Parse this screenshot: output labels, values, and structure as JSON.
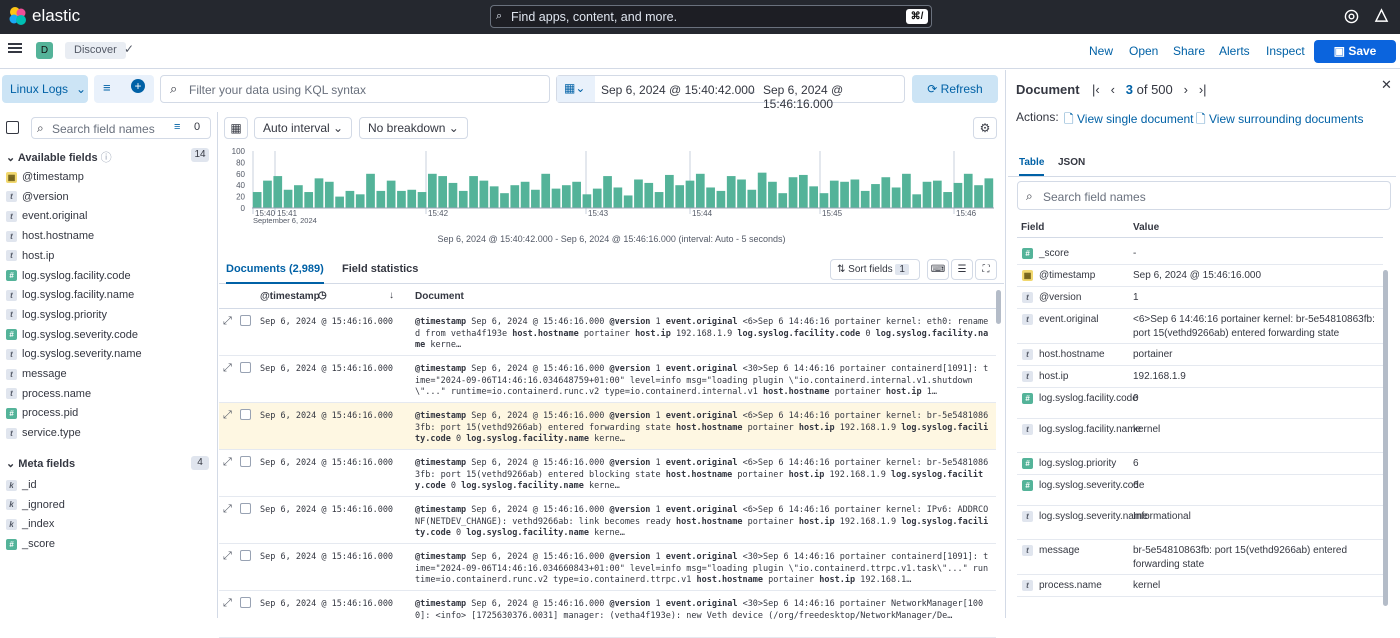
{
  "header": {
    "brand": "elastic",
    "search_placeholder": "Find apps, content, and more.",
    "search_shortcut": "⌘/"
  },
  "subheader": {
    "space_letter": "D",
    "breadcrumb": "Discover",
    "links": [
      "New",
      "Open",
      "Share",
      "Alerts",
      "Inspect"
    ],
    "save_label": "Save"
  },
  "querybar": {
    "dataview": "Linux Logs",
    "kql_placeholder": "Filter your data using KQL syntax",
    "date_start": "Sep 6, 2024 @ 15:40:42.000",
    "date_arrow": "→",
    "date_end": "Sep 6, 2024 @ 15:46:16.000",
    "refresh_label": "Refresh"
  },
  "sidebar": {
    "search_placeholder": "Search field names",
    "filter_count": "0",
    "available_title": "Available fields",
    "available_count": "14",
    "available": [
      {
        "type": "date",
        "name": "@timestamp"
      },
      {
        "type": "str",
        "name": "@version"
      },
      {
        "type": "str",
        "name": "event.original"
      },
      {
        "type": "str",
        "name": "host.hostname"
      },
      {
        "type": "str",
        "name": "host.ip"
      },
      {
        "type": "num",
        "name": "log.syslog.facility.code"
      },
      {
        "type": "str",
        "name": "log.syslog.facility.name"
      },
      {
        "type": "str",
        "name": "log.syslog.priority"
      },
      {
        "type": "num",
        "name": "log.syslog.severity.code"
      },
      {
        "type": "str",
        "name": "log.syslog.severity.name"
      },
      {
        "type": "str",
        "name": "message"
      },
      {
        "type": "str",
        "name": "process.name"
      },
      {
        "type": "num",
        "name": "process.pid"
      },
      {
        "type": "str",
        "name": "service.type"
      }
    ],
    "meta_title": "Meta fields",
    "meta_count": "4",
    "meta": [
      {
        "type": "kw",
        "name": "_id"
      },
      {
        "type": "kw",
        "name": "_ignored"
      },
      {
        "type": "kw",
        "name": "_index"
      },
      {
        "type": "num",
        "name": "_score"
      }
    ]
  },
  "chart_controls": {
    "interval": "Auto interval",
    "breakdown": "No breakdown"
  },
  "chart_data": {
    "type": "bar",
    "y_ticks": [
      "100",
      "80",
      "60",
      "40",
      "20",
      "0"
    ],
    "ylim": [
      0,
      100
    ],
    "x_ticks": [
      "15:40",
      "15:41",
      "15:42",
      "15:43",
      "15:44",
      "15:45",
      "15:46"
    ],
    "x_sublabel": "September 6, 2024",
    "caption": "Sep 6, 2024 @ 15:40:42.000 - Sep 6, 2024 @ 15:46:16.000 (interval: Auto - 5 seconds)",
    "values": [
      28,
      48,
      56,
      32,
      40,
      28,
      52,
      46,
      20,
      30,
      24,
      60,
      30,
      48,
      30,
      32,
      28,
      60,
      56,
      44,
      30,
      56,
      48,
      38,
      26,
      40,
      46,
      32,
      60,
      34,
      40,
      46,
      24,
      34,
      56,
      36,
      22,
      50,
      44,
      28,
      58,
      40,
      48,
      60,
      36,
      30,
      56,
      50,
      32,
      62,
      46,
      26,
      54,
      58,
      38,
      26,
      48,
      46,
      50,
      30,
      42,
      54,
      36,
      60,
      24,
      46,
      48,
      28,
      44,
      60,
      40,
      52
    ]
  },
  "docs": {
    "tab_documents": "Documents (2,989)",
    "tab_stats": "Field statistics",
    "sort_label": "Sort fields",
    "sort_count": "1",
    "col_timestamp": "@timestamp",
    "col_document": "Document",
    "rows": [
      {
        "ts": "Sep 6, 2024 @ 15:46:16.000",
        "doc": "@timestamp Sep 6, 2024 @ 15:46:16.000 @version 1 event.original <6>Sep 6 14:46:16 portainer kernel: eth0: renamed from vetha4f193e host.hostname portainer host.ip 192.168.1.9 log.syslog.facility.code 0 log.syslog.facility.name kerne…"
      },
      {
        "ts": "Sep 6, 2024 @ 15:46:16.000",
        "doc": "@timestamp Sep 6, 2024 @ 15:46:16.000 @version 1 event.original <30>Sep 6 14:46:16 portainer containerd[1091]: time=\"2024-09-06T14:46:16.034648759+01:00\" level=info msg=\"loading plugin \\\"io.containerd.internal.v1.shutdown\\\"...\" runtime=io.containerd.runc.v2 type=io.containerd.internal.v1 host.hostname portainer host.ip 1…"
      },
      {
        "ts": "Sep 6, 2024 @ 15:46:16.000",
        "doc": "@timestamp Sep 6, 2024 @ 15:46:16.000 @version 1 event.original <6>Sep 6 14:46:16 portainer kernel: br-5e54810863fb: port 15(vethd9266ab) entered forwarding state host.hostname portainer host.ip 192.168.1.9 log.syslog.facility.code 0 log.syslog.facility.name kerne…"
      },
      {
        "ts": "Sep 6, 2024 @ 15:46:16.000",
        "doc": "@timestamp Sep 6, 2024 @ 15:46:16.000 @version 1 event.original <6>Sep 6 14:46:16 portainer kernel: br-5e54810863fb: port 15(vethd9266ab) entered blocking state host.hostname portainer host.ip 192.168.1.9 log.syslog.facility.code 0 log.syslog.facility.name kerne…"
      },
      {
        "ts": "Sep 6, 2024 @ 15:46:16.000",
        "doc": "@timestamp Sep 6, 2024 @ 15:46:16.000 @version 1 event.original <6>Sep 6 14:46:16 portainer kernel: IPv6: ADDRCONF(NETDEV_CHANGE): vethd9266ab: link becomes ready host.hostname portainer host.ip 192.168.1.9 log.syslog.facility.code 0 log.syslog.facility.name kerne…"
      },
      {
        "ts": "Sep 6, 2024 @ 15:46:16.000",
        "doc": "@timestamp Sep 6, 2024 @ 15:46:16.000 @version 1 event.original <30>Sep 6 14:46:16 portainer containerd[1091]: time=\"2024-09-06T14:46:16.034660843+01:00\" level=info msg=\"loading plugin \\\"io.containerd.ttrpc.v1.task\\\"...\" runtime=io.containerd.runc.v2 type=io.containerd.ttrpc.v1 host.hostname portainer host.ip 192.168.1…"
      },
      {
        "ts": "Sep 6, 2024 @ 15:46:16.000",
        "doc": "@timestamp Sep 6, 2024 @ 15:46:16.000 @version 1 event.original <30>Sep 6 14:46:16 portainer NetworkManager[1000]: <info> [1725630376.0031] manager: (vetha4f193e): new Veth device (/org/freedesktop/NetworkManager/De…"
      }
    ]
  },
  "flyout": {
    "title": "Document",
    "page_current": "3",
    "page_of": "of",
    "page_total": "500",
    "actions_label": "Actions:",
    "action_single": "View single document",
    "action_surrounding": "View surrounding documents",
    "tab_table": "Table",
    "tab_json": "JSON",
    "search_placeholder": "Search field names",
    "col_field": "Field",
    "col_value": "Value",
    "rows": [
      {
        "type": "num",
        "field": "_score",
        "value": "-"
      },
      {
        "type": "date",
        "field": "@timestamp",
        "value": "Sep 6, 2024 @ 15:46:16.000"
      },
      {
        "type": "str",
        "field": "@version",
        "value": "1"
      },
      {
        "type": "str",
        "field": "event.original",
        "value": "<6>Sep  6 14:46:16 portainer kernel: br-5e54810863fb: port 15(vethd9266ab) entered forwarding state"
      },
      {
        "type": "str",
        "field": "host.hostname",
        "value": "portainer"
      },
      {
        "type": "str",
        "field": "host.ip",
        "value": "192.168.1.9"
      },
      {
        "type": "num",
        "field": "log.syslog.facility.code",
        "value": "0"
      },
      {
        "type": "str",
        "field": "log.syslog.facility.name",
        "value": "kernel"
      },
      {
        "type": "num",
        "field": "log.syslog.priority",
        "value": "6"
      },
      {
        "type": "num",
        "field": "log.syslog.severity.code",
        "value": "6"
      },
      {
        "type": "str",
        "field": "log.syslog.severity.name",
        "value": "Informational"
      },
      {
        "type": "str",
        "field": "message",
        "value": "br-5e54810863fb: port 15(vethd9266ab) entered forwarding state"
      },
      {
        "type": "str",
        "field": "process.name",
        "value": "kernel"
      }
    ]
  },
  "colors": {
    "accent": "#0b64dd",
    "bar": "#54b399",
    "topbar": "#25282f"
  }
}
